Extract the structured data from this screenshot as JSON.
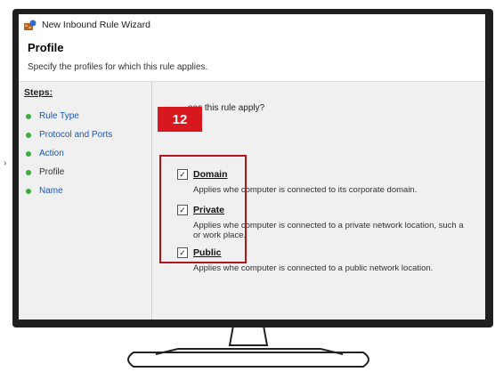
{
  "window": {
    "title": "New Inbound Rule Wizard"
  },
  "header": {
    "title": "Profile",
    "subtitle": "Specify the profiles for which this rule applies."
  },
  "steps": {
    "title": "Steps:",
    "items": [
      {
        "label": "Rule Type"
      },
      {
        "label": "Protocol and Ports"
      },
      {
        "label": "Action"
      },
      {
        "label": "Profile"
      },
      {
        "label": "Name"
      }
    ]
  },
  "content": {
    "question": "oes this rule apply?",
    "options": [
      {
        "label": "Domain",
        "checked": true,
        "description": "Applies whe  computer is connected to its corporate domain."
      },
      {
        "label": "Private",
        "checked": true,
        "description": "Applies whe  computer is connected to a private network location, such a",
        "description2": "or work place."
      },
      {
        "label": "Public",
        "checked": true,
        "description": "Applies whe  computer is connected to a public network location."
      }
    ]
  },
  "annotation": {
    "badge": "12",
    "color": "#d7181f"
  },
  "side_mark": "›"
}
